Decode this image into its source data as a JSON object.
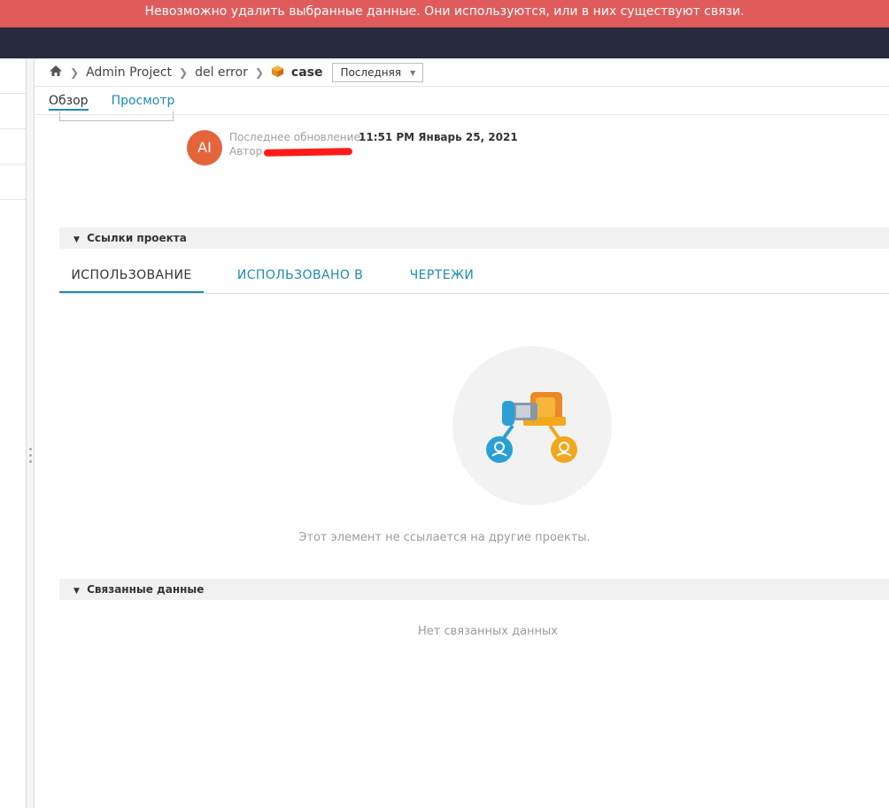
{
  "error_banner": {
    "message": "Невозможно удалить выбранные данные. Они используются, или в них существуют связи."
  },
  "breadcrumb": {
    "home_icon": "home-icon",
    "items": [
      "Admin Project",
      "del error",
      "case"
    ],
    "item_icon": "part-cube-icon",
    "version_select": {
      "value": "Последняя"
    }
  },
  "subnav": {
    "tabs": [
      "Обзор",
      "Просмотр"
    ],
    "active": "Обзор"
  },
  "meta": {
    "avatar_initials": "AI",
    "avatar_color": "#e4643c",
    "last_update_label": "Последнее обновление",
    "last_update_value": "11:51 PM Январь 25, 2021",
    "author_label": "Автор"
  },
  "sections": {
    "project_links": {
      "title": "Ссылки проекта"
    },
    "related_data": {
      "title": "Связанные данные"
    }
  },
  "reference_tabs": {
    "items": [
      "ИСПОЛЬЗОВАНИЕ",
      "ИСПОЛЬЗОВАНО В",
      "ЧЕРТЕЖИ"
    ],
    "active": "ИСПОЛЬЗОВАНИЕ"
  },
  "empty_states": {
    "project_links": "Этот элемент не ссылается на другие проекты.",
    "related_data": "Нет связанных данных"
  },
  "colors": {
    "error": "#e05c5c",
    "topbar": "#262a3f",
    "accent": "#1c8ab4"
  }
}
